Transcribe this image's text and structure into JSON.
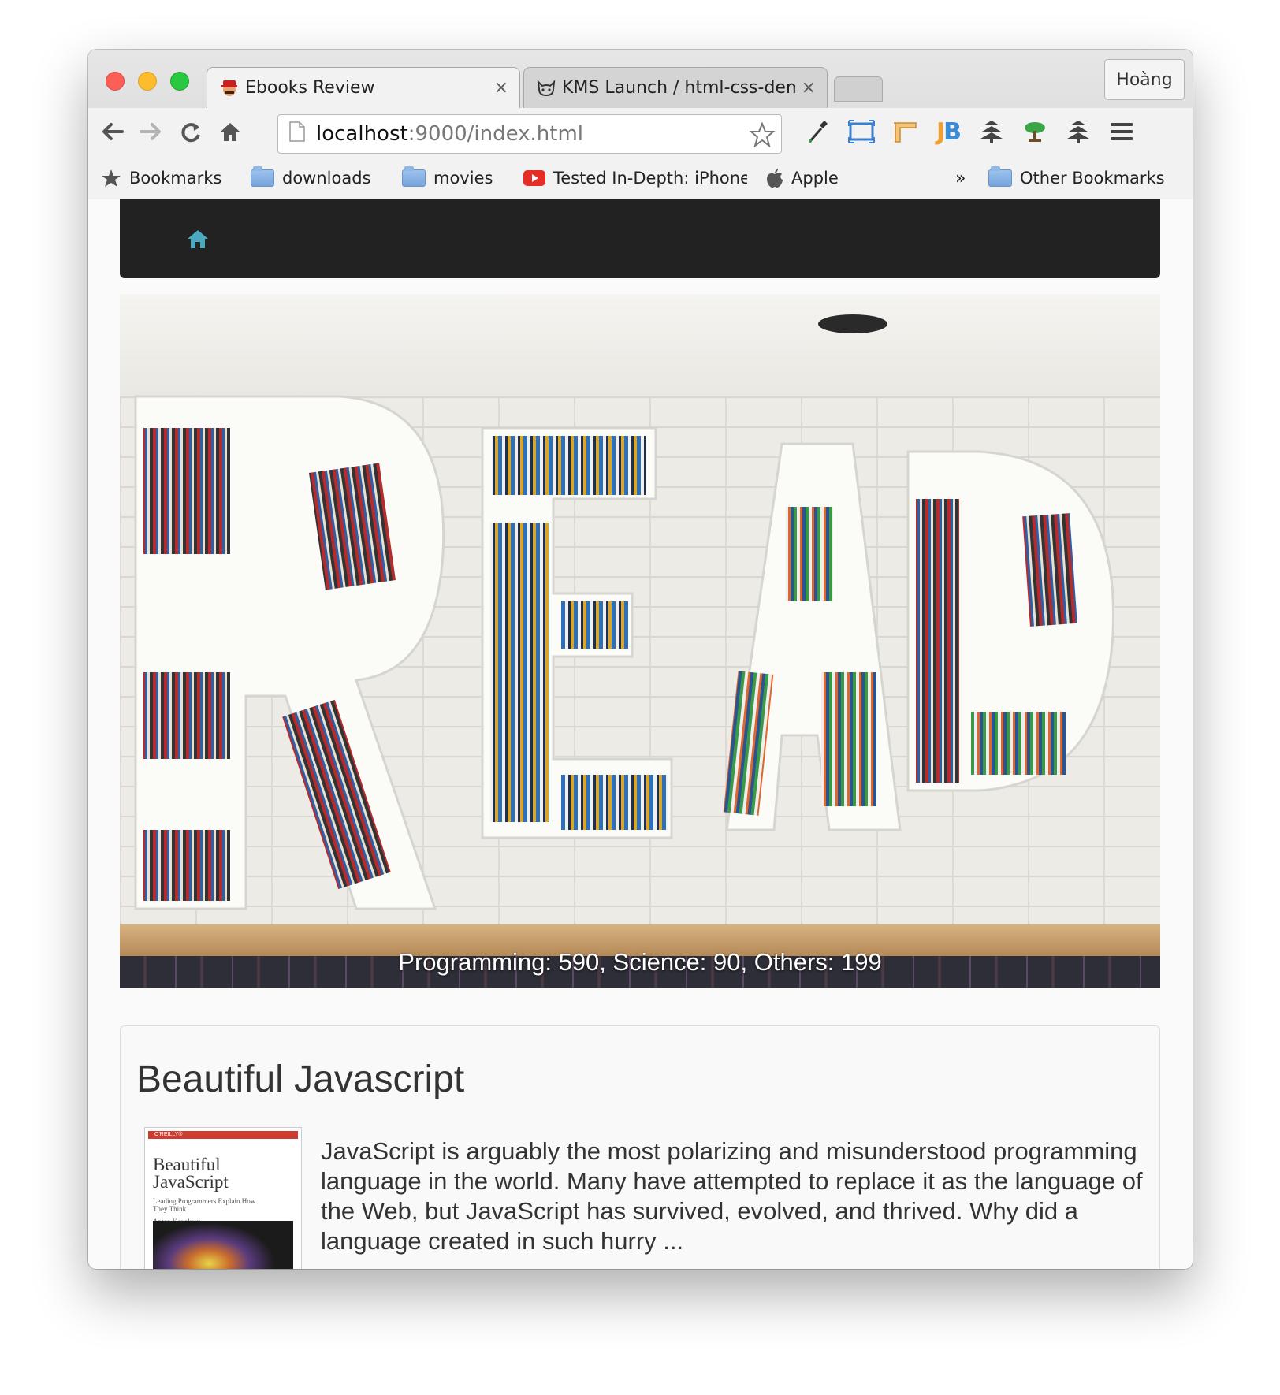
{
  "browser": {
    "tabs": [
      {
        "title": "Ebooks Review",
        "active": true,
        "close": "×"
      },
      {
        "title": "KMS Launch / html-css-demo",
        "active": false,
        "close": "×"
      }
    ],
    "profile_name": "Hoàng",
    "url_host": "localhost",
    "url_path": ":9000/index.html",
    "bookmarks": [
      {
        "label": "Bookmarks",
        "icon": "star-icon"
      },
      {
        "label": "downloads",
        "icon": "folder-icon"
      },
      {
        "label": "movies",
        "icon": "folder-icon"
      },
      {
        "label": "Tested In-Depth: iPhone",
        "icon": "youtube-icon"
      },
      {
        "label": "Apple",
        "icon": "apple-icon"
      }
    ],
    "overflow_chevron": "»",
    "other_bookmarks": "Other Bookmarks"
  },
  "hero": {
    "caption": "Programming: 590, Science: 90, Others: 199"
  },
  "book": {
    "title": "Beautiful Javascript",
    "cover": {
      "brand": "O'REILLY®",
      "title_line1": "Beautiful",
      "title_line2": "JavaScript",
      "subtitle": "Leading Programmers Explain How They Think",
      "author": "Anton Kovalyov"
    },
    "description": "JavaScript is arguably the most polarizing and misunderstood programming language in the world. Many have attempted to replace it as the language of the Web, but JavaScript has survived, evolved, and thrived. Why did a language created in such hurry ..."
  },
  "colors": {
    "navbar": "#222222",
    "home_icon": "#4aa8c0",
    "close_red": "#fc5f57",
    "minimize_yellow": "#fdbc2e",
    "maximize_green": "#28c840"
  }
}
